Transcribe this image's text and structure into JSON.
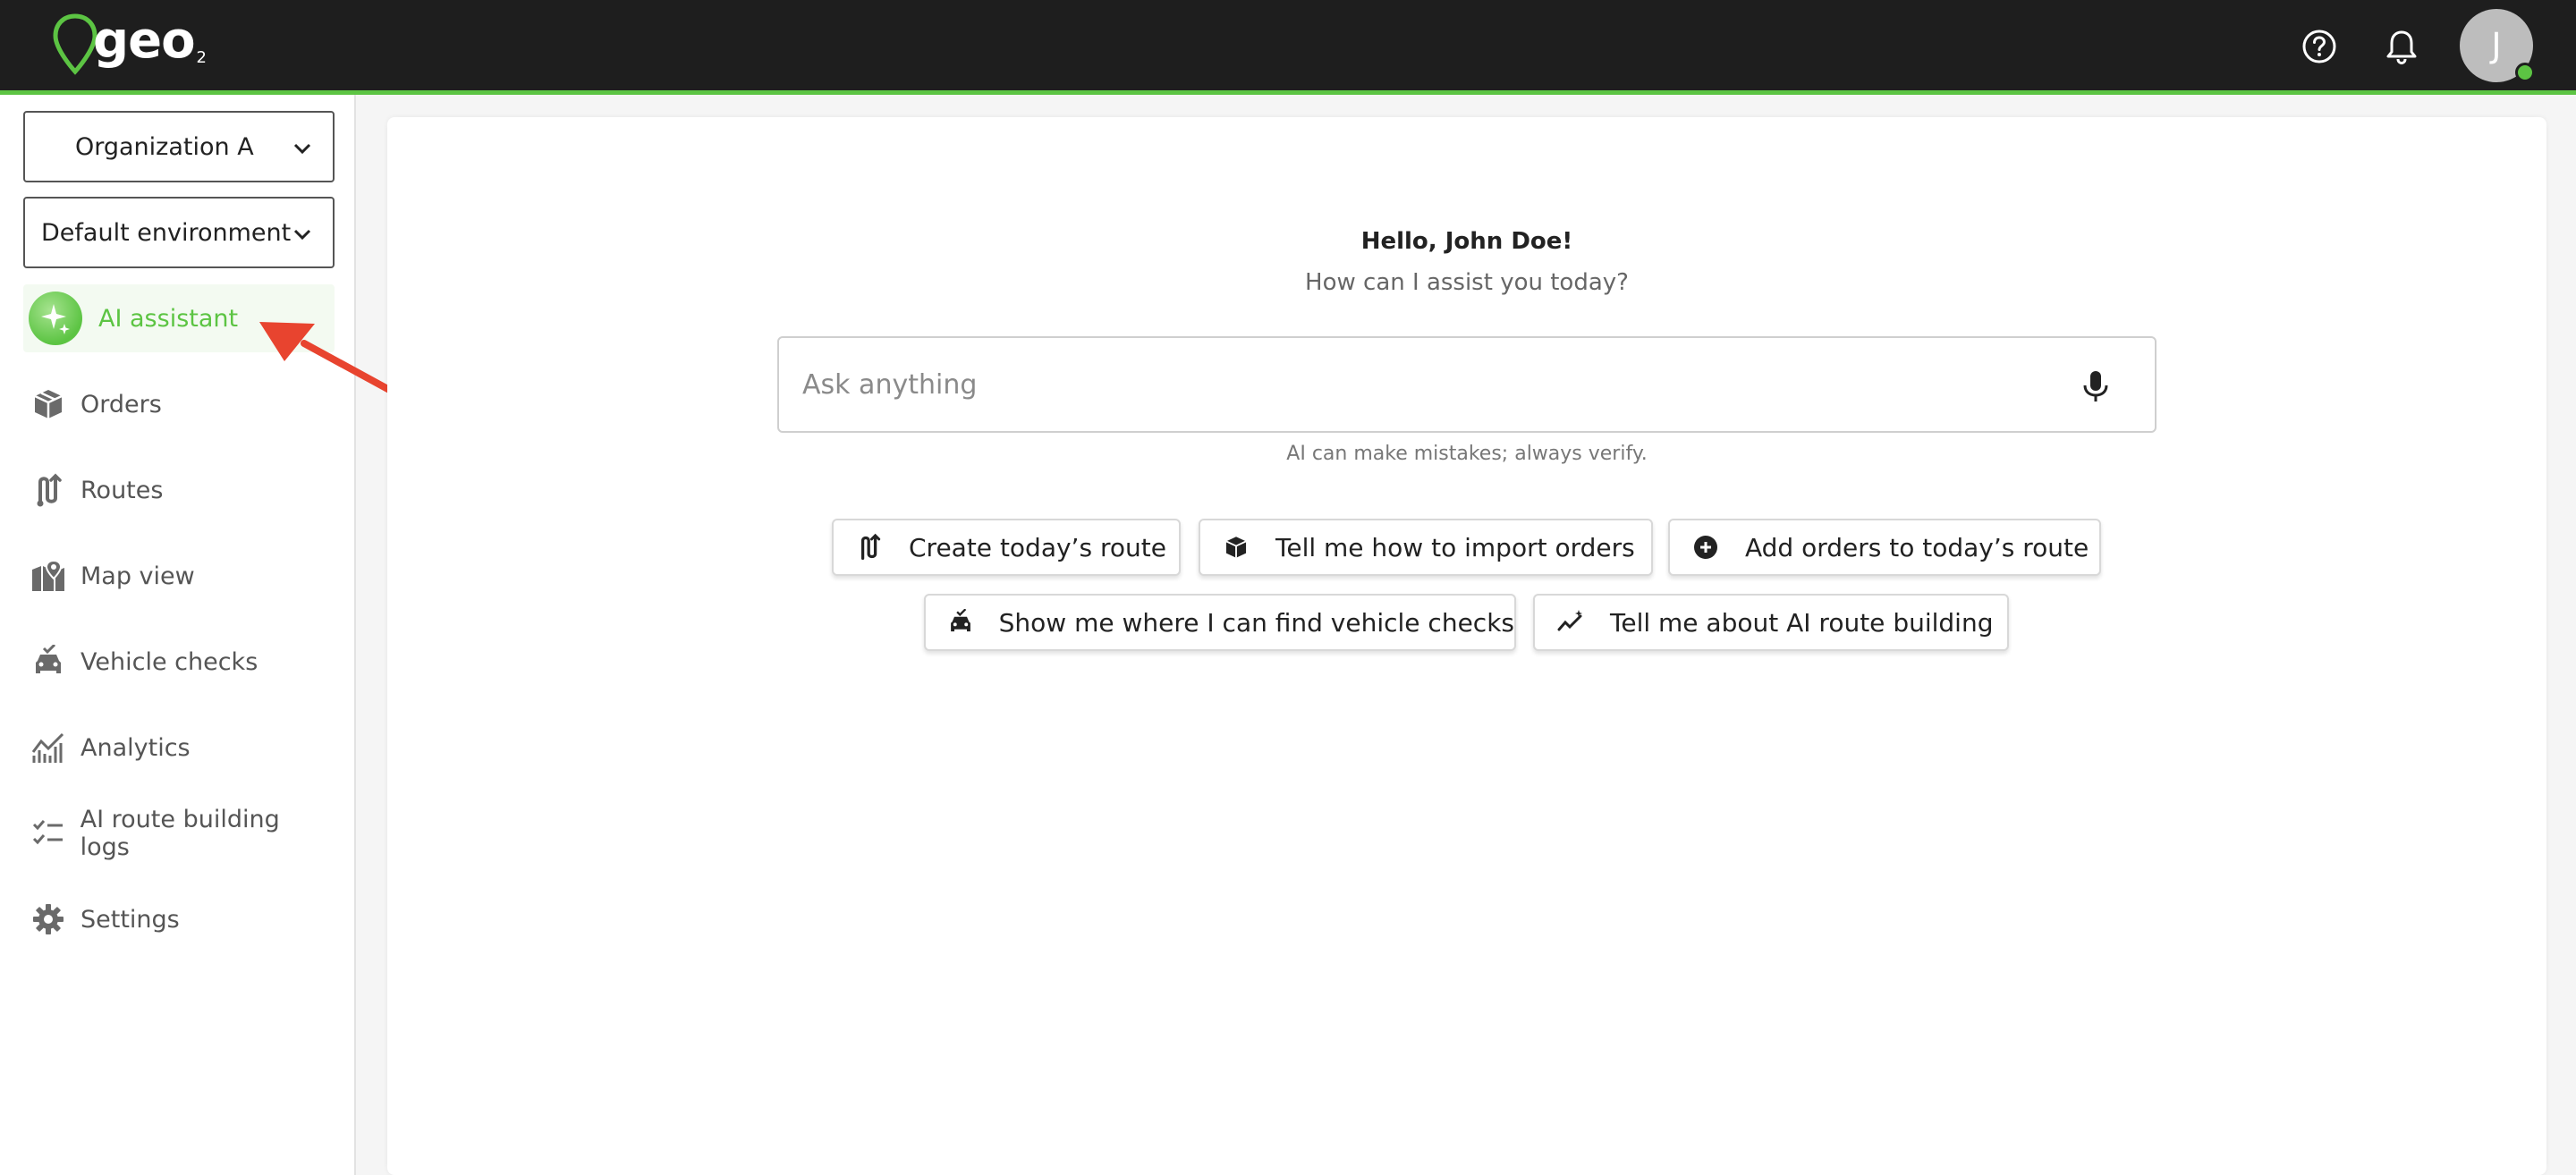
{
  "header": {
    "logo_text": "geo",
    "logo_sub": "2",
    "help_icon": "help-circle-icon",
    "bell_icon": "bell-icon",
    "avatar_initial": "J",
    "colors": {
      "bar": "#1e1e1e",
      "accent": "#5cc443"
    }
  },
  "sidebar": {
    "organization": "Organization A",
    "environment": "Default environment",
    "items": [
      {
        "label": "AI assistant",
        "icon": "sparkle-icon",
        "active": true
      },
      {
        "label": "Orders",
        "icon": "box-icon"
      },
      {
        "label": "Routes",
        "icon": "route-icon"
      },
      {
        "label": "Map view",
        "icon": "map-pin-icon"
      },
      {
        "label": "Vehicle checks",
        "icon": "car-check-icon"
      },
      {
        "label": "Analytics",
        "icon": "analytics-icon"
      },
      {
        "label": "AI route building logs",
        "icon": "checklist-icon"
      },
      {
        "label": "Settings",
        "icon": "gear-icon"
      }
    ]
  },
  "main": {
    "greeting": "Hello, John Doe!",
    "subtitle": "How can I assist you today?",
    "ask_placeholder": "Ask anything",
    "disclaimer": "AI can make mistakes; always verify.",
    "suggestions": [
      {
        "label": "Create today’s route",
        "icon": "route-icon"
      },
      {
        "label": "Tell me how to import orders",
        "icon": "box-icon"
      },
      {
        "label": "Add orders to today’s route",
        "icon": "plus-circle-icon"
      },
      {
        "label": "Show me where I can find vehicle checks",
        "icon": "car-check-icon"
      },
      {
        "label": "Tell me about AI route building",
        "icon": "ai-trend-icon"
      }
    ]
  }
}
